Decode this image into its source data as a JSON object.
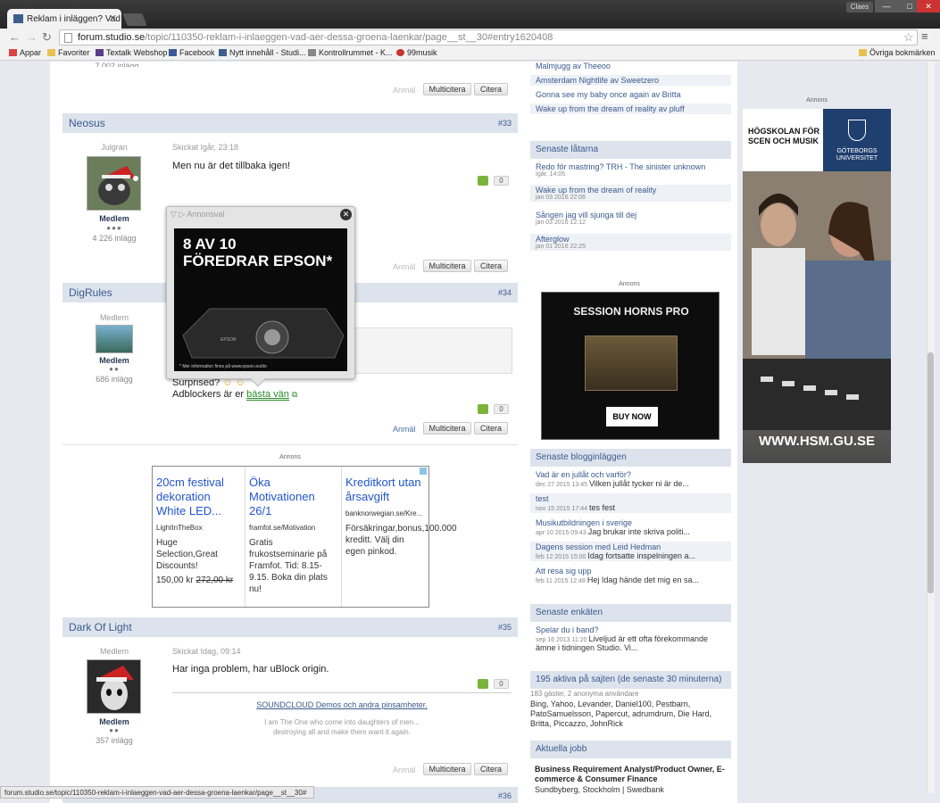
{
  "browser": {
    "tab_title": "Reklam i inläggen? Vad ä",
    "url_host": "forum.studio.se",
    "url_path": "/topic/110350-reklam-i-inlaeggen-vad-aer-dessa-groena-laenkar/page__st__30#entry1620408",
    "user": "Claes",
    "status_url": "forum.studio.se/topic/110350-reklam-i-inlaeggen-vad-aer-dessa-groena-laenkar/page__st__30#"
  },
  "bookmarks": {
    "apps": "Appar",
    "items": [
      "Favoriter",
      "Textalk Webshop",
      "Facebook",
      "Nytt innehåll - Studi...",
      "Kontrollrummet - K...",
      "99musik"
    ],
    "other": "Övriga bokmärken"
  },
  "top_prev": {
    "count": "7 002 inlägg"
  },
  "labels": {
    "anmal": "Anmäl",
    "multicitera": "Multicitera",
    "citera": "Citera",
    "annons": "Annons"
  },
  "posts": [
    {
      "author": "Neosus",
      "num": "#33",
      "title": "Julgran",
      "rank": "Medlem",
      "dots": "●●●",
      "count": "4 226 inlägg",
      "meta": "Skickat Igår, 23:18",
      "text": "Men nu är det tillbaka igen!",
      "score": "0"
    },
    {
      "author": "DigRules",
      "num": "#34",
      "title": "Medlem",
      "rank": "Medlem",
      "dots": "●●",
      "count": "686 inlägg",
      "meta": "",
      "text1": "Surprised?",
      "text2": "Adblockers är er",
      "link": "bästa vän",
      "score": "0"
    },
    {
      "author": "Dark Of Light",
      "num": "#35",
      "title": "Medlem",
      "rank": "Medlem",
      "dots": "●●",
      "count": "357 inlägg",
      "meta": "Skickat Idag, 09:14",
      "text": "Har inga problem, har uBlock origin.",
      "score": "0",
      "sig_link": "SOUNDCLOUD Demos och andra pinsamheter.",
      "sig_text1": "I am The One who come into daughters of men...",
      "sig_text2": "destroying all and make them want it again."
    }
  ],
  "next_post_num": "#36",
  "popup": {
    "title": "Annonsval",
    "headline1": "8 AV 10",
    "headline2": "FÖREDRAR EPSON*",
    "fine": "* Mer information finns på www.epson.eu/do",
    "brand": "EPSON"
  },
  "adsense": [
    {
      "title": "20cm festival dekoration White LED...",
      "domain": "LightInTheBox",
      "desc": "Huge Selection,Great Discounts!",
      "price": "150,00 kr",
      "old": "272,00 kr"
    },
    {
      "title": "Öka Motivationen 26/1",
      "domain": "framfot.se/Motivation",
      "desc": "Gratis frukostseminarie på Framfot. Tid: 8.15-9.15. Boka din plats nu!"
    },
    {
      "title": "Kreditkort utan årsavgift",
      "domain": "banknorwegian.se/Kre...",
      "desc": "Försäkringar,bonus,100.000 kreditt. Välj din egen pinkod."
    }
  ],
  "sidebar": {
    "top_items": [
      "Malmjugg av Theeoo",
      "Amsterdam Nightlife av Sweetzero",
      "Gonna see my baby once again av Britta",
      "Wake up from the dream of reality av pluff"
    ],
    "songs_head": "Senaste låtarna",
    "songs": [
      {
        "t": "Redo för mastring? TRH - The sinister unknown",
        "d": "Igår, 14:05"
      },
      {
        "t": "Wake up from the dream of reality",
        "d": "jan 03 2016 22:06"
      },
      {
        "t": "Sången jag vill sjunga till dej",
        "d": "jan 03 2016 12:12"
      },
      {
        "t": "Afterglow",
        "d": "jan 01 2016 22:25"
      }
    ],
    "ad_title": "SESSION HORNS PRO",
    "ad_btn": "BUY NOW",
    "blog_head": "Senaste blogginläggen",
    "blogs": [
      {
        "t": "Vad är en jullåt och varför?",
        "d": "dec 27 2015 13:45",
        "s": "Vilken jullåt tycker ni är de..."
      },
      {
        "t": "test",
        "d": "nov 15 2015 17:44",
        "s": "tes fest"
      },
      {
        "t": "Musikutbildningen i sverige",
        "d": "apr 10 2015 09:43",
        "s": "Jag brukar inte skriva politi..."
      },
      {
        "t": "Dagens session med Leid Hedman",
        "d": "feb 12 2015 15:00",
        "s": "Idag fortsatte inspelningen a..."
      },
      {
        "t": "Att resa sig upp",
        "d": "feb 11 2015 12:48",
        "s": "Hej Idag hände det mig en sa..."
      }
    ],
    "poll_head": "Senaste enkäten",
    "poll": {
      "t": "Spelar du i band?",
      "d": "sep 16 2013 11:20",
      "s": "Liveljud är ett ofta förekommande ämne i tidningen Studio. Vi..."
    },
    "active_head": "195 aktiva på sajten (de senaste 30 minuterna)",
    "active_sub": "183 gäster, 2 anonyma användare",
    "active_users": "Bing, Yahoo, Levander, Daniel100, Pestbarn, PatoSamuelsson, Papercut, adrumdrum, Die Hard, Britta, Piccazzo, JohnRick",
    "jobs_head": "Aktuella jobb",
    "job_title": "Business Requirement Analyst/Product Owner, E-commerce & Consumer Finance",
    "job_loc": "Sundbyberg, Stockholm | Swedbank"
  },
  "right_ad": {
    "line1": "HÖGSKOLAN FÖR",
    "line2": "SCEN OCH MUSIK",
    "uni1": "GÖTEBORGS",
    "uni2": "UNIVERSITET",
    "url": "WWW.HSM.GU.SE"
  }
}
